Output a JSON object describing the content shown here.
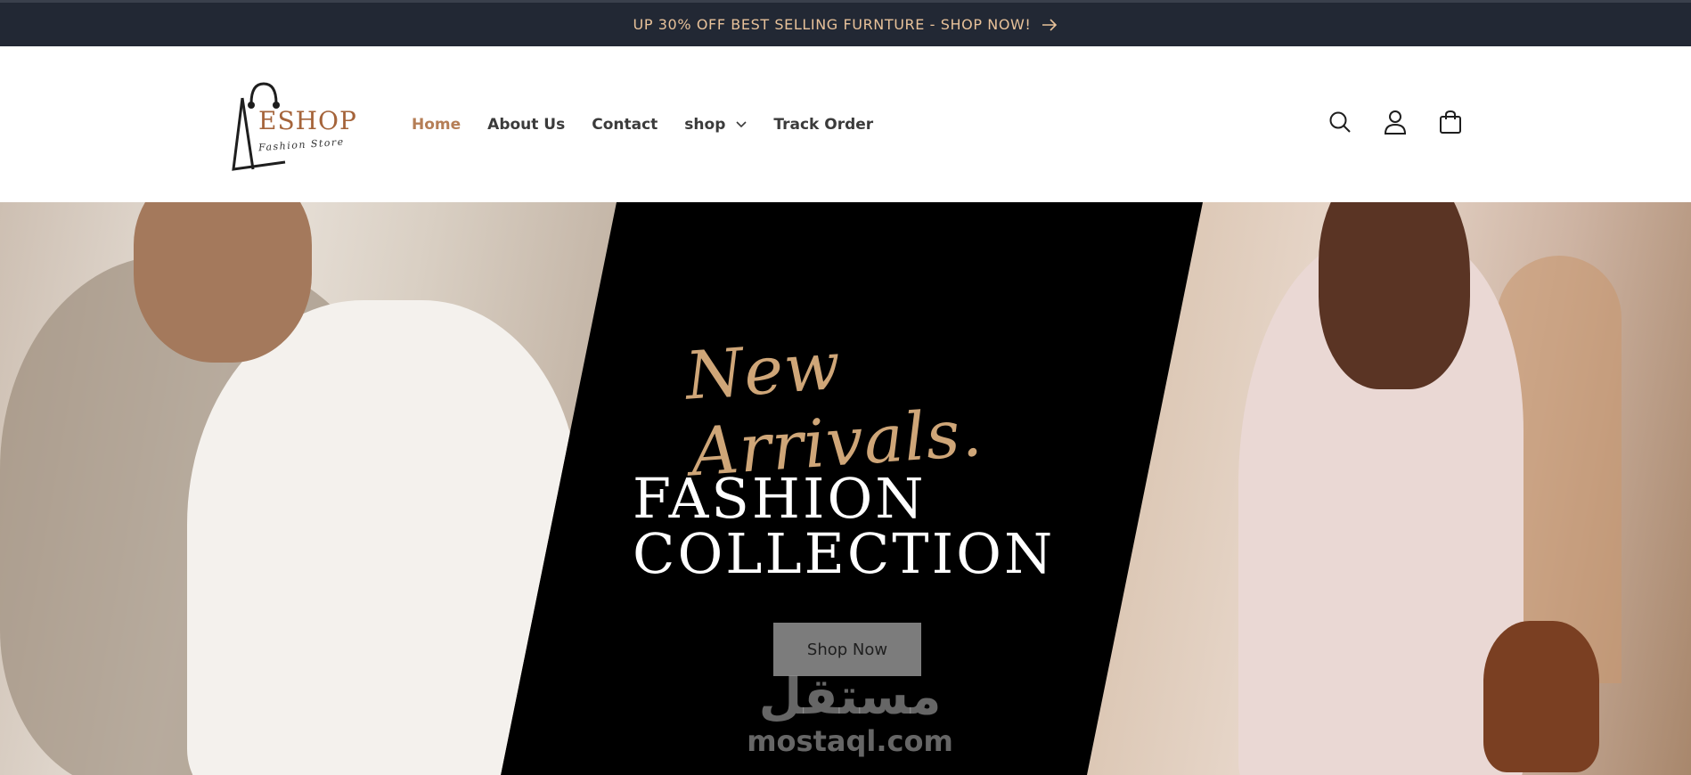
{
  "announcement": {
    "text": "UP 30% OFF BEST SELLING FURNTURE - SHOP NOW!"
  },
  "header": {
    "logo": {
      "brand": "ESHOP",
      "tagline": "Fashion Store"
    },
    "nav": [
      {
        "label": "Home",
        "active": true
      },
      {
        "label": "About Us"
      },
      {
        "label": "Contact"
      },
      {
        "label": "shop",
        "has_dropdown": true
      },
      {
        "label": "Track Order"
      }
    ],
    "icons": [
      "search-icon",
      "account-icon",
      "cart-icon"
    ]
  },
  "hero": {
    "script_title": "New Arrivals.",
    "title_line1": "FASHION",
    "title_line2": "COLLECTION",
    "cta_label": "Shop Now",
    "watermark_arabic": "مستقل",
    "watermark_latin": "mostaql.com"
  },
  "colors": {
    "announcement_bg": "#222834",
    "announcement_text": "#e8c29a",
    "accent": "#b57e56",
    "hero_bg": "#000000",
    "script_gold": "#cfa678"
  }
}
